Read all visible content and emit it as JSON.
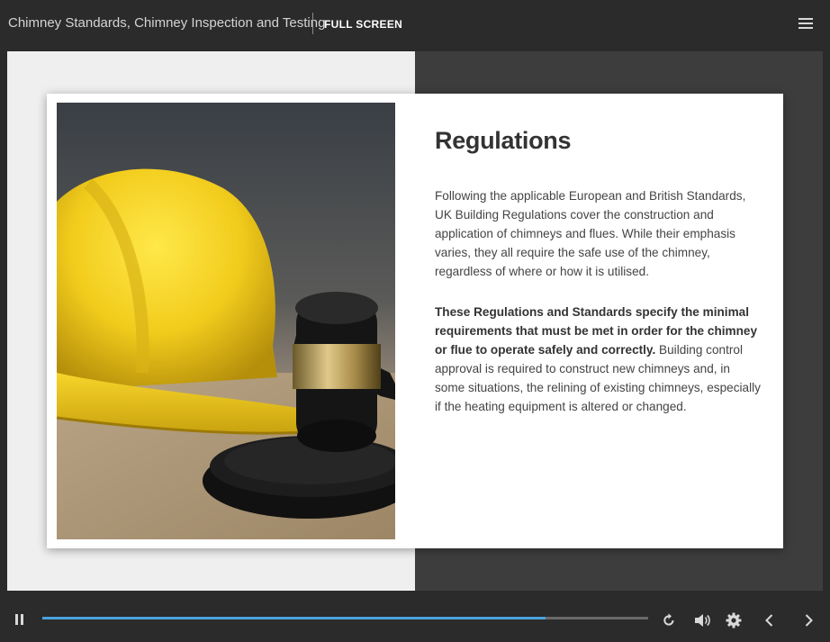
{
  "header": {
    "course_title": "Chimney Standards, Chimney Inspection and Testing",
    "fullscreen_label": "FULL SCREEN"
  },
  "slide": {
    "title": "Regulations",
    "paragraph1": "Following the applicable European and British Standards, UK Building Regulations cover the construction and application of chimneys and flues. While their emphasis varies, they all require the safe use of the chimney, regardless of where or how it is utilised.",
    "paragraph2_bold": "These Regulations and Standards specify the minimal requirements that must be met in order for the chimney or flue to operate safely and correctly.",
    "paragraph2_rest": " Building control approval is required to construct new chimneys and, in some situations, the relining of existing chimneys, especially if the heating equipment is altered or changed."
  },
  "player": {
    "progress_fraction": 0.83,
    "icons": [
      "pause-icon",
      "replay-icon",
      "volume-icon",
      "settings-icon",
      "prev-icon",
      "next-icon",
      "menu-icon"
    ]
  },
  "colors": {
    "accent": "#4aa3df",
    "chrome": "#2b2b2b",
    "helmet_yellow": "#f2cc1c"
  }
}
